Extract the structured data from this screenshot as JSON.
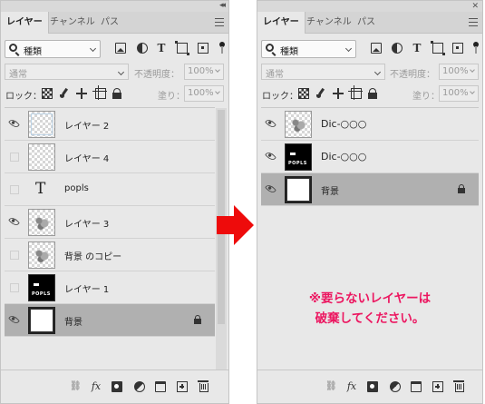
{
  "tabs": [
    "レイヤー",
    "チャンネル",
    "パス"
  ],
  "filter": {
    "kind_label": "種類"
  },
  "blend": {
    "mode": "通常",
    "opacity_label": "不透明度：",
    "opacity_value": "100%"
  },
  "lock": {
    "label": "ロック：",
    "fill_label": "塗り：",
    "fill_value": "100%"
  },
  "left_layers": [
    {
      "name": "レイヤー 2",
      "visible": true,
      "thumb": "blue"
    },
    {
      "name": "レイヤー 4",
      "visible": false,
      "thumb": "transparent"
    },
    {
      "name": "popls",
      "visible": false,
      "thumb": "type",
      "type_glyph": "T"
    },
    {
      "name": "レイヤー 3",
      "visible": true,
      "thumb": "photo"
    },
    {
      "name": "背景 のコピー",
      "visible": false,
      "thumb": "photo"
    },
    {
      "name": "レイヤー 1",
      "visible": false,
      "thumb": "black",
      "thumb_text": "POPLS"
    },
    {
      "name": "背景",
      "visible": true,
      "thumb": "white",
      "selected": true,
      "locked": true
    }
  ],
  "right_layers": [
    {
      "name": "Dic-○○○",
      "visible": true,
      "thumb": "photo"
    },
    {
      "name": "Dic-○○○",
      "visible": true,
      "thumb": "black",
      "thumb_text": "POPLS"
    },
    {
      "name": "背景",
      "visible": true,
      "thumb": "white",
      "selected": true,
      "locked": true
    }
  ],
  "note": {
    "line1": "※要らないレイヤーは",
    "line2": "破棄してください。"
  },
  "colors": {
    "arrow": "#ee0b0b",
    "note": "#ec1660",
    "selected_row": "#b0b0b0"
  }
}
